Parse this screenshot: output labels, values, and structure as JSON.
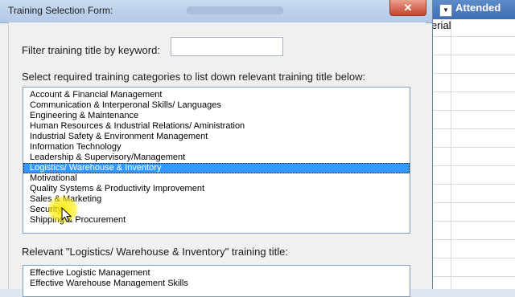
{
  "window": {
    "title": "Training Selection Form:",
    "close_glyph": "✕"
  },
  "background_sheet": {
    "filter_glyph": "▼",
    "column_header": "Attended",
    "cell_text": "erial"
  },
  "filter": {
    "label": "Filter training title by keyword:",
    "value": ""
  },
  "categories": {
    "label": "Select required training categories to list down relevant training title below:",
    "selected_index": 7,
    "items": [
      "Account & Financial Management",
      "Communication & Interperonal Skills/ Languages",
      "Engineering & Maintenance",
      "Human Resources & Industrial Relations/ Aministration",
      "Industrial Safety & Environment Management",
      "Information Technology",
      "Leadership & Supervisory/Management",
      "Logistics/ Warehouse & Inventory",
      "Motivational",
      "Quality Systems & Productivity Improvement",
      "Sales & Marketing",
      "Security",
      "Shipping & Procurement"
    ]
  },
  "titles": {
    "label": "Relevant \"Logistics/ Warehouse & Inventory\" training title:",
    "items": [
      "Effective Logistic Management",
      "Effective Warehouse Management Skills"
    ]
  },
  "colors": {
    "selection": "#3399ff",
    "cursor_highlight": "#ffeb00"
  }
}
